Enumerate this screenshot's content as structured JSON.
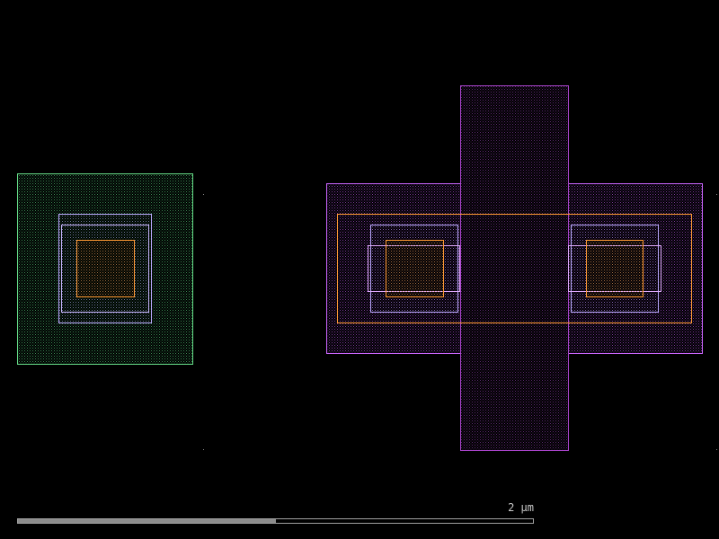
{
  "background_color": "#000000",
  "layer_colors": {
    "nwell": "#66dd88",
    "diffusion": "#cc66ff",
    "poly": "#aa44cc",
    "implant": "#bbaaff",
    "via": "#e0aaff",
    "contact": "#ff9933"
  },
  "scale_bar": {
    "label": "2 µm",
    "progress": 0.5
  }
}
